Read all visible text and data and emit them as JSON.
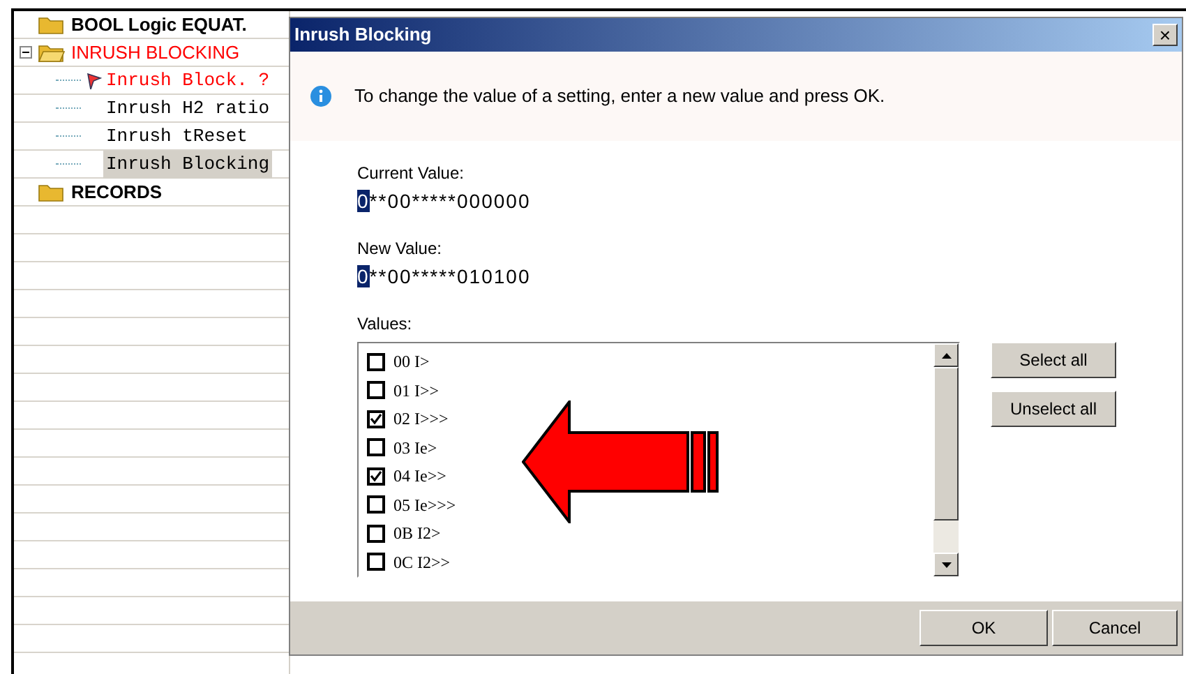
{
  "tree": {
    "items": [
      {
        "kind": "folder",
        "label": "BOOL Logic EQUAT.",
        "alert": false,
        "expanded": false,
        "selected": false
      },
      {
        "kind": "folder",
        "label": "INRUSH BLOCKING",
        "alert": true,
        "expanded": true,
        "selected": false,
        "children": [
          {
            "kind": "setting",
            "label": "Inrush Block. ?",
            "alert": true,
            "selected": false
          },
          {
            "kind": "setting",
            "label": "Inrush H2 ratio",
            "alert": false,
            "selected": false
          },
          {
            "kind": "setting",
            "label": "Inrush tReset",
            "alert": false,
            "selected": false
          },
          {
            "kind": "setting",
            "label": "Inrush Blocking",
            "alert": false,
            "selected": true
          }
        ]
      },
      {
        "kind": "folder",
        "label": "RECORDS",
        "alert": false,
        "expanded": false,
        "selected": false
      }
    ]
  },
  "dialog": {
    "title": "Inrush Blocking",
    "close": "×",
    "info": "To change the value of a setting, enter a new value and press OK.",
    "current_label": "Current Value:",
    "current_cursor": "0",
    "current_value": "**00*****000000",
    "new_label": "New Value:",
    "new_cursor": "0",
    "new_value": "**00*****010100",
    "values_label": "Values:",
    "values": [
      {
        "label": "00 I>",
        "checked": false
      },
      {
        "label": "01 I>>",
        "checked": false
      },
      {
        "label": "02 I>>>",
        "checked": true
      },
      {
        "label": "03 Ie>",
        "checked": false
      },
      {
        "label": "04 Ie>>",
        "checked": true
      },
      {
        "label": "05 Ie>>>",
        "checked": false
      },
      {
        "label": "0B I2>",
        "checked": false
      },
      {
        "label": "0C I2>>",
        "checked": false
      }
    ],
    "side_buttons": [
      "Select all",
      "Unselect all"
    ],
    "buttons": [
      "OK",
      "Cancel"
    ]
  }
}
